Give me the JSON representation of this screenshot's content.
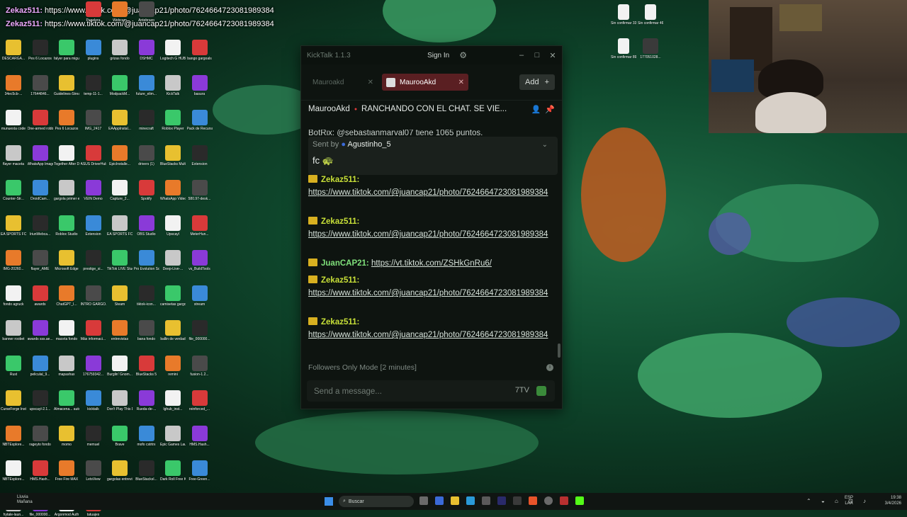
{
  "overlay": {
    "lines": [
      {
        "user": "Zekaz511:",
        "text": " https://www.tiktok.com/@juancap21/photo/7624664723081989384"
      },
      {
        "user": "Zekaz511:",
        "text": " https://www.tiktok.com/@juancap21/photo/7624664723081989384"
      }
    ]
  },
  "desktop_icons": [
    {
      "label": "Papelera"
    },
    {
      "label": "Webcam"
    },
    {
      "label": "Antebrazo"
    },
    {
      "label": "DESCARGA..."
    },
    {
      "label": "Pes 6 Locazos"
    },
    {
      "label": "falyer para miguel"
    },
    {
      "label": "plugins"
    },
    {
      "label": "grizas fondo"
    },
    {
      "label": "DSHMC"
    },
    {
      "label": "Logitech G HUB"
    },
    {
      "label": "bango gargoals"
    },
    {
      "label": "34ec5cb-..."
    },
    {
      "label": "17644846..."
    },
    {
      "label": "Guidelines-Streams"
    },
    {
      "label": "temp-11-1..."
    },
    {
      "label": "ModpackM..."
    },
    {
      "label": "future_elim..."
    },
    {
      "label": "KickTalk"
    },
    {
      "label": "basura"
    },
    {
      "label": "munuesta code"
    },
    {
      "label": "One-armed robber"
    },
    {
      "label": "Pes 6 Locazos"
    },
    {
      "label": "IMG_2417"
    },
    {
      "label": "EAAppInstal..."
    },
    {
      "label": "minecraft"
    },
    {
      "label": "Roblox Player"
    },
    {
      "label": "Pack de Recursos"
    },
    {
      "label": "flayer maceta"
    },
    {
      "label": "WhatsApp Image 2026"
    },
    {
      "label": "Together After Dark"
    },
    {
      "label": "ASUS DriverHub"
    },
    {
      "label": "EpicInstalle..."
    },
    {
      "label": "drivers (1)"
    },
    {
      "label": "BlueStacks Multi-Insta..."
    },
    {
      "label": "Extension"
    },
    {
      "label": "Counter-Str..."
    },
    {
      "label": "DroidCam..."
    },
    {
      "label": "gargola primer e..."
    },
    {
      "label": "VEIN Demo"
    },
    {
      "label": "Capture_2..."
    },
    {
      "label": "Spotify"
    },
    {
      "label": "WhatsApp Video 2025"
    },
    {
      "label": "580.97-desk..."
    },
    {
      "label": "EA SPORTS FC 26"
    },
    {
      "label": "IriunWebca..."
    },
    {
      "label": "Roblox Studio"
    },
    {
      "label": "Extension"
    },
    {
      "label": "EA SPORTS FC 26"
    },
    {
      "label": "OBS Studio"
    },
    {
      "label": "Upscayl"
    },
    {
      "label": "MeterHun..."
    },
    {
      "label": "IMG-20260..."
    },
    {
      "label": "flayer_AME"
    },
    {
      "label": "Microsoft Edge"
    },
    {
      "label": "prestige_si..."
    },
    {
      "label": "TikTok LIVE Studio"
    },
    {
      "label": "Pro Evolution Soccer 6"
    },
    {
      "label": "Deep-Live-..."
    },
    {
      "label": "vs_BuildTools"
    },
    {
      "label": "fondo agruck"
    },
    {
      "label": "awards"
    },
    {
      "label": "ChatGPT_I..."
    },
    {
      "label": "INTRO GARGO..."
    },
    {
      "label": "Steam"
    },
    {
      "label": "tiktok-icon..."
    },
    {
      "label": "camisetas gargolas"
    },
    {
      "label": "stream"
    },
    {
      "label": "banner roobet"
    },
    {
      "label": "awards sss.ae..."
    },
    {
      "label": "maceta fondo"
    },
    {
      "label": "Más informaci..."
    },
    {
      "label": "entrevistas"
    },
    {
      "label": "bana fondo"
    },
    {
      "label": "ballin de verdad"
    },
    {
      "label": "file_000000..."
    },
    {
      "label": "Rust"
    },
    {
      "label": "peliculal_9..."
    },
    {
      "label": "mapashax"
    },
    {
      "label": "176759342..."
    },
    {
      "label": "Burglin' Gnom..."
    },
    {
      "label": "BlueStacks 5"
    },
    {
      "label": "remini"
    },
    {
      "label": "fusion-1.2..."
    },
    {
      "label": "CurseForge Installer"
    },
    {
      "label": "upscayl-2.1..."
    },
    {
      "label": "Almacena... automatic..."
    },
    {
      "label": "kicktalk"
    },
    {
      "label": "Don't Play This Demo"
    },
    {
      "label": "Rueda-de-..."
    },
    {
      "label": "lghub_inst..."
    },
    {
      "label": "reinforced_..."
    },
    {
      "label": "NBTExplore..."
    },
    {
      "label": "rageyto fondo"
    },
    {
      "label": "momo"
    },
    {
      "label": "memuel"
    },
    {
      "label": "Brave"
    },
    {
      "label": "mofo cstrtrx"
    },
    {
      "label": "Epic Games Launcher"
    },
    {
      "label": "HMS.Hash..."
    },
    {
      "label": "NBTExplore..."
    },
    {
      "label": "HMS.Hash..."
    },
    {
      "label": "Free Fire MAX"
    },
    {
      "label": "LetsView"
    },
    {
      "label": "gargolas entrevistas"
    },
    {
      "label": "BlueStacksI..."
    },
    {
      "label": "Dark Roll Free Kic..."
    },
    {
      "label": "Free-Green..."
    },
    {
      "label": "hytale-laun..."
    },
    {
      "label": "file_000000..."
    },
    {
      "label": "Argonmod Auth"
    },
    {
      "label": "tatuajes"
    }
  ],
  "right_icons": [
    {
      "label": "Sin confirmar 338672.crdl..."
    },
    {
      "label": "Sin confirmar 462937.crd..."
    },
    {
      "label": "Sin confirmar 894333.crd..."
    },
    {
      "label": "177051028..."
    }
  ],
  "kicktalk": {
    "app_title": "KickTalk 1.1.3",
    "signin": "Sign In",
    "tabs": [
      {
        "label": "Mauroakd",
        "active": false
      },
      {
        "label": "MaurooAkd",
        "active": true
      }
    ],
    "add_label": "Add",
    "channel": {
      "name": "MaurooAkd",
      "title": "RANCHANDO CON EL CHAT. SE VIE..."
    },
    "partial_top": "BotRix: @sebastianmarval07 tiene 1065 puntos.",
    "pinned": {
      "sent_by_prefix": "Sent by",
      "user": "Agustinho_5",
      "message": "fc 🐢"
    },
    "messages": [
      {
        "user": "Zekaz511:",
        "link": "https://www.tiktok.com/@juancap21/photo/7624664723081989384",
        "color": "yellow"
      },
      {
        "user": "Zekaz511:",
        "link": "https://www.tiktok.com/@juancap21/photo/7624664723081989384",
        "color": "yellow"
      },
      {
        "user": "JuanCAP21:",
        "link": "https://vt.tiktok.com/ZSHkGnRu6/",
        "color": "green"
      },
      {
        "user": "Zekaz511:",
        "link": "https://www.tiktok.com/@juancap21/photo/7624664723081989384",
        "color": "yellow"
      },
      {
        "user": "Zekaz511:",
        "link": "https://www.tiktok.com/@juancap21/photo/7624664723081989384",
        "color": "yellow"
      }
    ],
    "followers_mode": "Followers Only Mode [2 minutes]",
    "input_placeholder": "Send a message..."
  },
  "taskbar": {
    "weather_line1": "Lluvia",
    "weather_line2": "Mañana",
    "search_placeholder": "Buscar",
    "lang1": "ESP",
    "lang2": "LAA",
    "time": "19:38",
    "date": "3/4/2026"
  }
}
